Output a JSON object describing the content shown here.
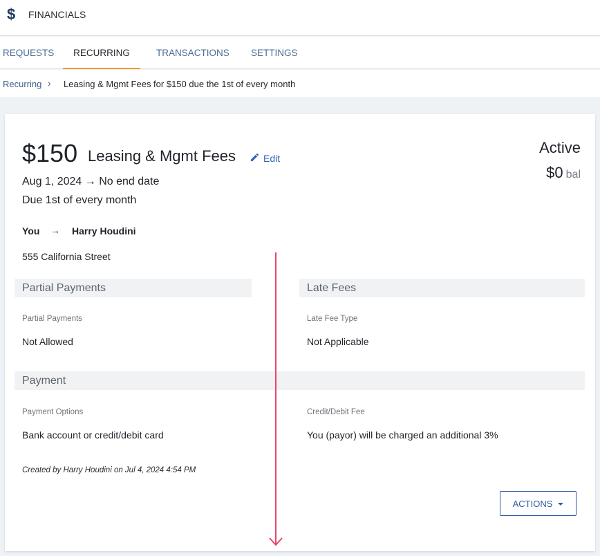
{
  "app": {
    "title": "FINANCIALS",
    "icon": "dollar-icon"
  },
  "tabs": [
    {
      "label": "REQUESTS",
      "active": false
    },
    {
      "label": "RECURRING",
      "active": true
    },
    {
      "label": "TRANSACTIONS",
      "active": false
    },
    {
      "label": "SETTINGS",
      "active": false
    }
  ],
  "breadcrumb": {
    "link": "Recurring",
    "separator": "›",
    "current": "Leasing & Mgmt Fees for $150 due the 1st of every month"
  },
  "recurring": {
    "amount": "$150",
    "fee_name": "Leasing & Mgmt Fees",
    "edit_label": "Edit",
    "dates": "Aug 1, 2024 → No end date",
    "due": "Due 1st of every month",
    "status": "Active",
    "balance": "$0",
    "balance_suffix": "bal",
    "from": "You",
    "arrow": "→",
    "to": "Harry Houdini",
    "address": "555 California Street"
  },
  "sections": {
    "partial_payments": {
      "heading": "Partial Payments",
      "label": "Partial Payments",
      "value": "Not Allowed"
    },
    "late_fees": {
      "heading": "Late Fees",
      "label": "Late Fee Type",
      "value": "Not Applicable"
    },
    "payment": {
      "heading": "Payment",
      "options_label": "Payment Options",
      "options_value": "Bank account or credit/debit card",
      "fee_label": "Credit/Debit Fee",
      "fee_value": "You (payor) will be charged an additional 3%"
    }
  },
  "created": "Created by Harry Houdini on Jul 4, 2024 4:54 PM",
  "actions_label": "ACTIONS",
  "colors": {
    "accent_tab": "#f29a2e",
    "link": "#3166b8",
    "annotation_arrow": "#e8456b"
  }
}
